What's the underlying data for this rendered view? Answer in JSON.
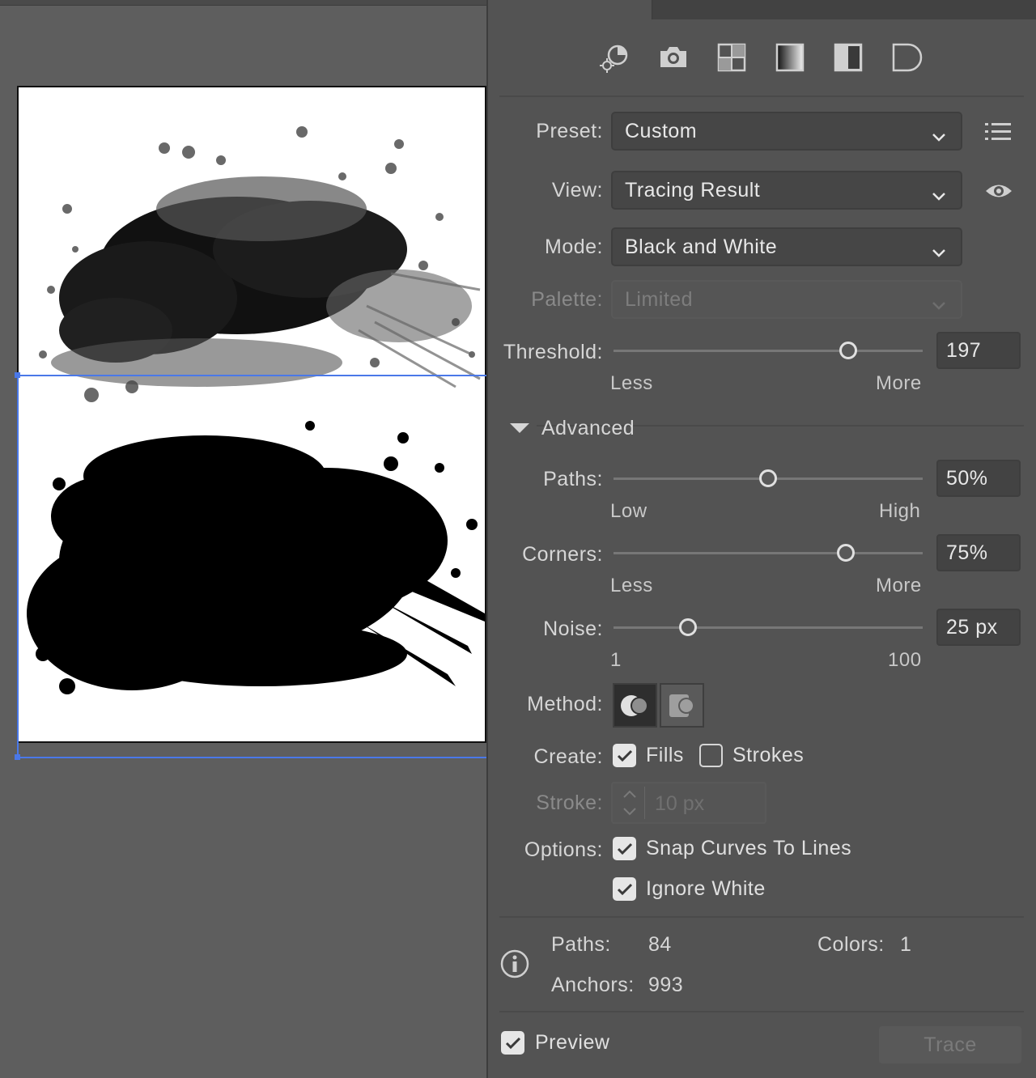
{
  "panel": {
    "preset": {
      "label": "Preset:",
      "value": "Custom"
    },
    "view": {
      "label": "View:",
      "value": "Tracing Result"
    },
    "mode": {
      "label": "Mode:",
      "value": "Black and White"
    },
    "palette": {
      "label": "Palette:",
      "value": "Limited"
    },
    "threshold": {
      "label": "Threshold:",
      "value": "197",
      "min_label": "Less",
      "max_label": "More",
      "level": 0.76
    },
    "advanced": {
      "label": "Advanced"
    },
    "paths": {
      "label": "Paths:",
      "value": "50%",
      "min_label": "Low",
      "max_label": "High",
      "level": 0.5
    },
    "corners": {
      "label": "Corners:",
      "value": "75%",
      "min_label": "Less",
      "max_label": "More",
      "level": 0.75
    },
    "noise": {
      "label": "Noise:",
      "value": "25 px",
      "min_label": "1",
      "max_label": "100",
      "level": 0.24
    },
    "method": {
      "label": "Method:"
    },
    "create": {
      "label": "Create:",
      "fills_label": "Fills",
      "fills_checked": true,
      "strokes_label": "Strokes",
      "strokes_checked": false
    },
    "stroke": {
      "label": "Stroke:",
      "value": "10 px"
    },
    "options": {
      "label": "Options:",
      "snap_label": "Snap Curves To Lines",
      "snap_checked": true,
      "ignore_white_label": "Ignore White",
      "ignore_white_checked": true
    },
    "info": {
      "paths_label": "Paths:",
      "paths_value": "84",
      "colors_label": "Colors:",
      "colors_value": "1",
      "anchors_label": "Anchors:",
      "anchors_value": "993"
    },
    "preview": {
      "label": "Preview",
      "checked": true
    },
    "trace_button": "Trace"
  },
  "colors": {
    "panel_bg": "#535353",
    "canvas_bg": "#5e5e5e",
    "selection": "#4a78e8"
  },
  "icons": [
    "auto-color-icon",
    "high-color-icon",
    "low-color-icon",
    "grayscale-icon",
    "black-and-white-icon",
    "outline-icon",
    "presets-menu-icon",
    "eye-icon",
    "info-icon"
  ]
}
